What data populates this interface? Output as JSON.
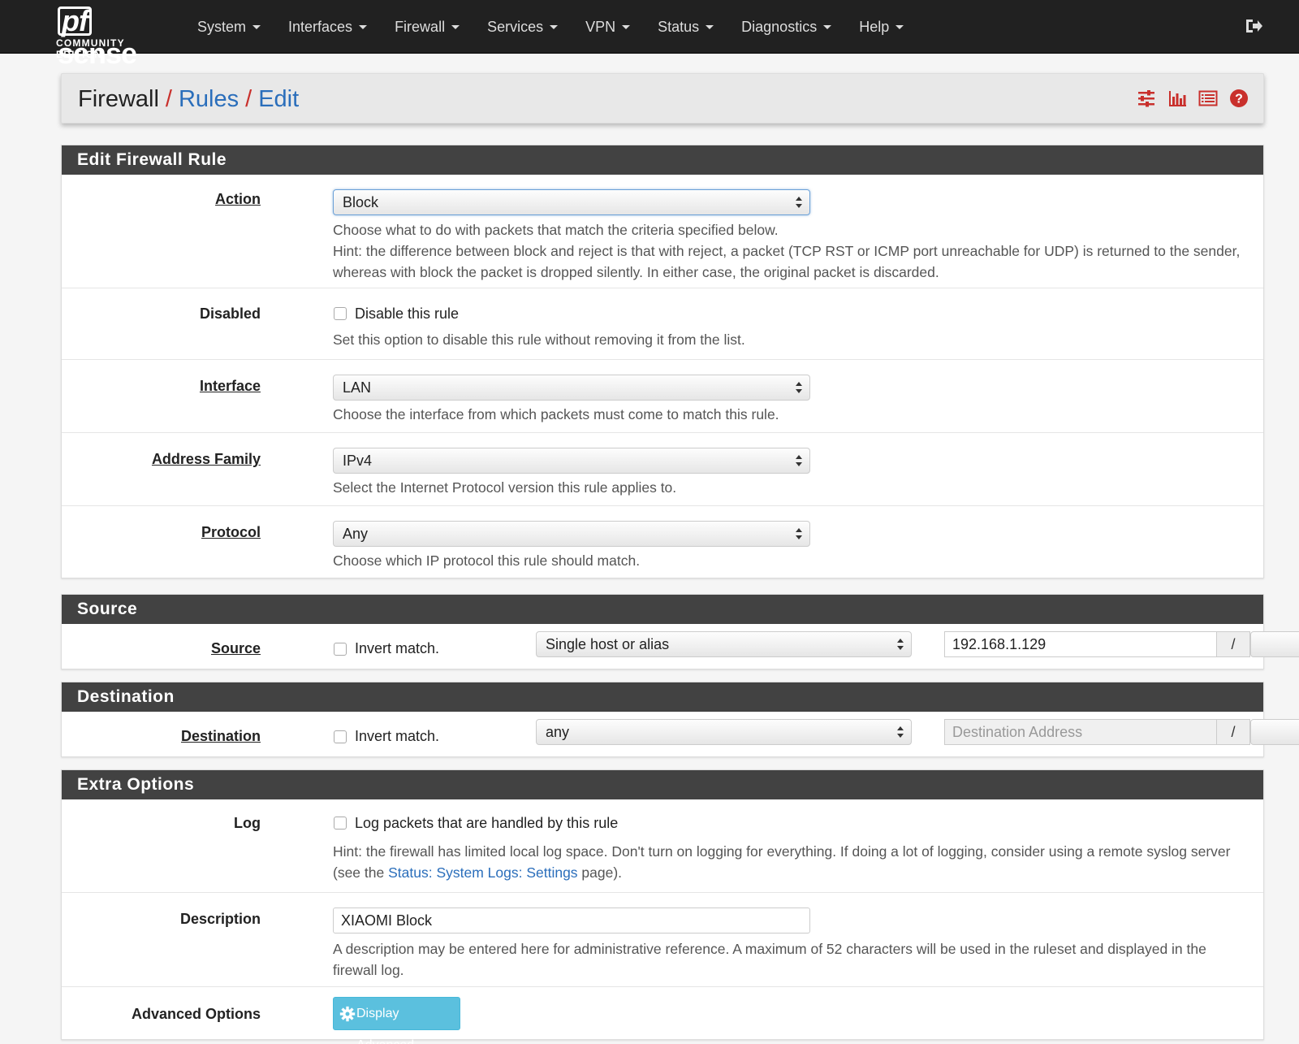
{
  "brand": {
    "name": "sense",
    "pf": "pf",
    "edition": "COMMUNITY EDITION"
  },
  "nav": [
    "System",
    "Interfaces",
    "Firewall",
    "Services",
    "VPN",
    "Status",
    "Diagnostics",
    "Help"
  ],
  "breadcrumb": {
    "root": "Firewall",
    "sep": "/",
    "rules": "Rules",
    "edit": "Edit"
  },
  "icons": {
    "settings": "sliders-icon",
    "chart": "bar-chart-icon",
    "log": "list-log-icon",
    "help": "question-circle-icon",
    "logout": "sign-out-icon",
    "gear": "gear-icon"
  },
  "colors": {
    "navbar": "#212121",
    "panel_head": "#424242",
    "link": "#2a6ebb",
    "accent_red": "#c9302c",
    "info_button": "#5bc0de"
  },
  "edit_rule": {
    "title": "Edit Firewall Rule",
    "action": {
      "label": "Action",
      "value": "Block",
      "help1": "Choose what to do with packets that match the criteria specified below.",
      "help2": "Hint: the difference between block and reject is that with reject, a packet (TCP RST or ICMP port unreachable for UDP) is returned to the sender, whereas with block the packet is dropped silently. In either case, the original packet is discarded."
    },
    "disabled": {
      "label": "Disabled",
      "checkbox": "Disable this rule",
      "help": "Set this option to disable this rule without removing it from the list."
    },
    "interface": {
      "label": "Interface",
      "value": "LAN",
      "help": "Choose the interface from which packets must come to match this rule."
    },
    "family": {
      "label": "Address Family",
      "value": "IPv4",
      "help": "Select the Internet Protocol version this rule applies to."
    },
    "protocol": {
      "label": "Protocol",
      "value": "Any",
      "help": "Choose which IP protocol this rule should match."
    }
  },
  "source": {
    "title": "Source",
    "label": "Source",
    "invert": "Invert match.",
    "type": "Single host or alias",
    "address": "192.168.1.129",
    "slash": "/"
  },
  "destination": {
    "title": "Destination",
    "label": "Destination",
    "invert": "Invert match.",
    "type": "any",
    "address_placeholder": "Destination Address",
    "slash": "/"
  },
  "extra": {
    "title": "Extra Options",
    "log": {
      "label": "Log",
      "checkbox": "Log packets that are handled by this rule",
      "hint_pre": "Hint: the firewall has limited local log space. Don't turn on logging for everything. If doing a lot of logging, consider using a remote syslog server (see the ",
      "hint_link": "Status: System Logs: Settings",
      "hint_post": " page)."
    },
    "description": {
      "label": "Description",
      "value": "XIAOMI Block",
      "help": "A description may be entered here for administrative reference. A maximum of 52 characters will be used in the ruleset and displayed in the firewall log."
    },
    "advanced": {
      "label": "Advanced Options",
      "button": "Display Advanced"
    }
  }
}
